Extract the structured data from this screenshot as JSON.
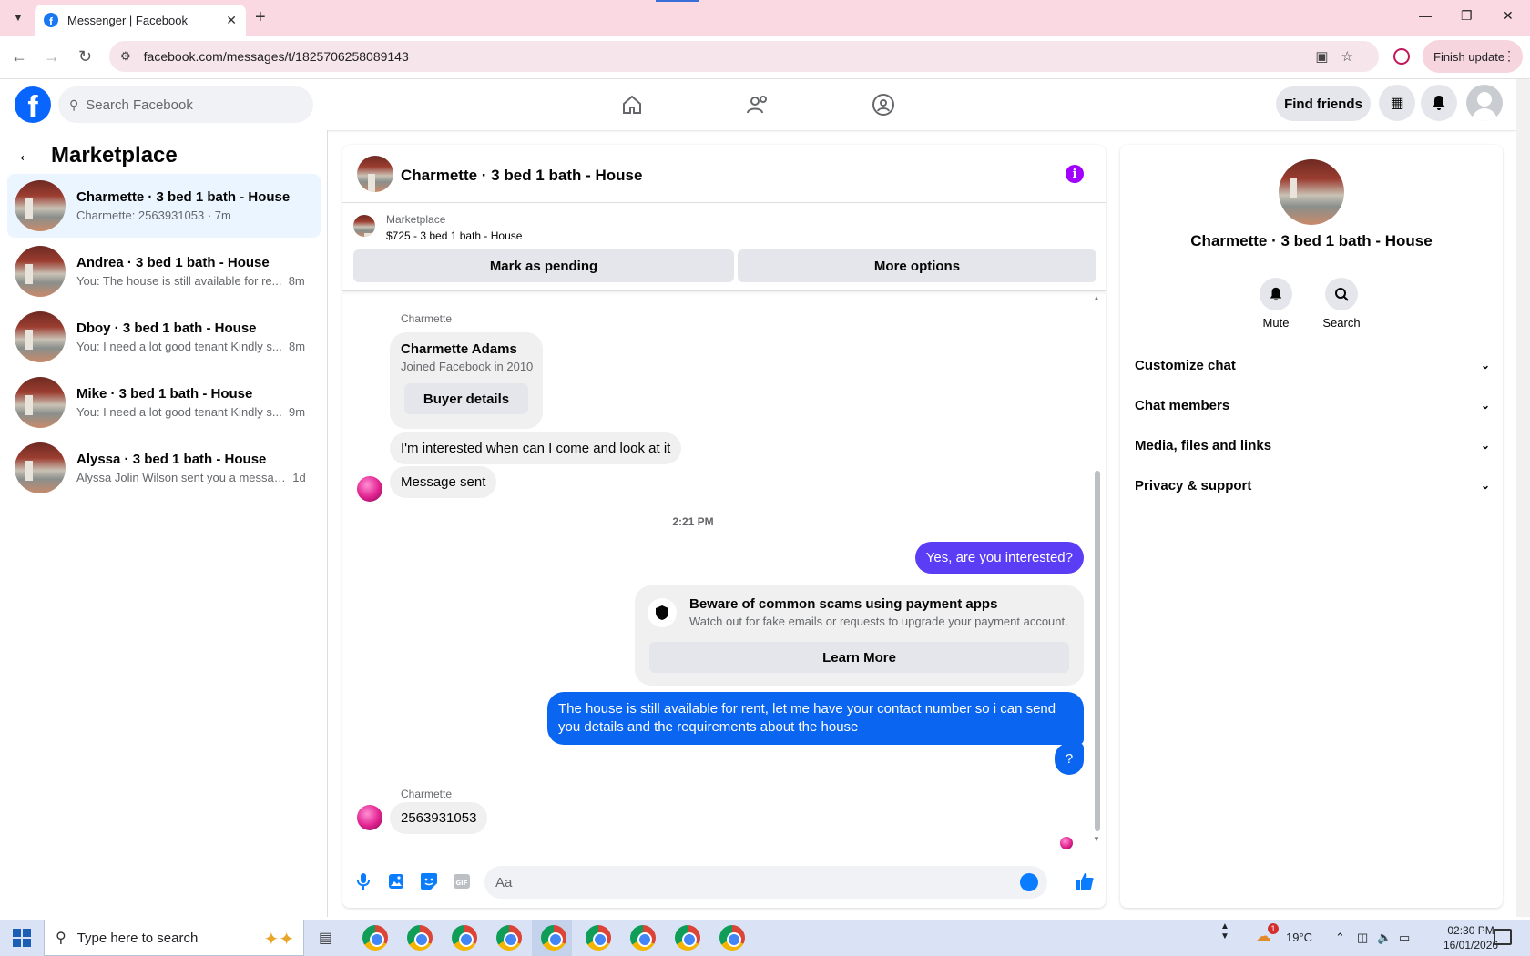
{
  "browser": {
    "tab_title": "Messenger | Facebook",
    "url": "facebook.com/messages/t/1825706258089143",
    "finish_update": "Finish update"
  },
  "fb": {
    "search_placeholder": "Search Facebook",
    "find_friends": "Find friends"
  },
  "sidebar": {
    "title": "Marketplace",
    "conversations": [
      {
        "name": "Charmette · 3 bed 1 bath - House",
        "snippet": "Charmette: 2563931053 · 7m",
        "time": "",
        "active": true
      },
      {
        "name": "Andrea · 3 bed 1 bath - House",
        "snippet": "You: The house is still available for re...",
        "time": "8m"
      },
      {
        "name": "Dboy · 3 bed 1 bath - House",
        "snippet": "You: I need a lot good tenant Kindly s...",
        "time": "8m"
      },
      {
        "name": "Mike · 3 bed 1 bath - House",
        "snippet": "You: I need a lot good tenant Kindly s...",
        "time": "9m"
      },
      {
        "name": "Alyssa · 3 bed 1 bath - House",
        "snippet": "Alyssa Jolin Wilson sent you a messag...",
        "time": "1d"
      }
    ]
  },
  "chat": {
    "title": "Charmette · 3 bed 1 bath - House",
    "marketplace_label": "Marketplace",
    "listing": "$725 - 3 bed 1 bath - House",
    "mark_pending": "Mark as pending",
    "more_options": "More options",
    "sender_name": "Charmette",
    "profile_card": {
      "name": "Charmette Adams",
      "joined": "Joined Facebook in 2010",
      "button": "Buyer details"
    },
    "msg_interested": "I'm interested when can I come and look at it",
    "msg_sent": "Message sent",
    "timestamp": "2:21 PM",
    "out_1": "Yes, are you interested?",
    "scam_title": "Beware of common scams using payment apps",
    "scam_desc": "Watch out for fake emails or requests to upgrade your payment account.",
    "learn_more": "Learn More",
    "out_2": "The house is still available for rent, let me have your contact number so i can send you details and the requirements about the house",
    "out_3": "?",
    "sender_name_2": "Charmette",
    "in_last": "2563931053",
    "composer_placeholder": "Aa"
  },
  "info_panel": {
    "name": "Charmette · 3 bed 1 bath - House",
    "mute": "Mute",
    "search": "Search",
    "sections": [
      "Customize chat",
      "Chat members",
      "Media, files and links",
      "Privacy & support"
    ]
  },
  "taskbar": {
    "search_placeholder": "Type here to search",
    "temperature": "19°C",
    "time": "02:30 PM",
    "date": "16/01/2026",
    "weather_badge": "1"
  },
  "colors": {
    "fb_blue": "#0866ff",
    "out_bubble": "#5b3df5",
    "out_bubble_blue": "#0a65f0",
    "accent": "#a100ff"
  }
}
